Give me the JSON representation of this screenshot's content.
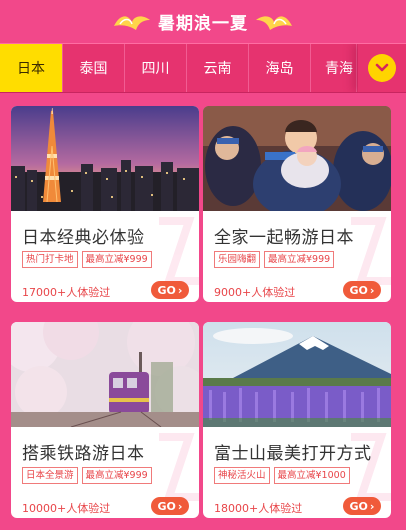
{
  "header": {
    "title": "暑期浪一夏"
  },
  "tabs": [
    {
      "label": "日本",
      "active": true
    },
    {
      "label": "泰国",
      "active": false
    },
    {
      "label": "四川",
      "active": false
    },
    {
      "label": "云南",
      "active": false
    },
    {
      "label": "海岛",
      "active": false
    },
    {
      "label": "青海",
      "active": false
    }
  ],
  "more_icon": "chevron-down-icon",
  "cards": [
    {
      "title": "日本经典必体验",
      "tags": [
        "热门打卡地",
        "最高立减¥999"
      ],
      "people": "17000+人体验过",
      "go": "GO",
      "image": "tokyo-tower-night"
    },
    {
      "title": "全家一起畅游日本",
      "tags": [
        "乐园嗨翻",
        "最高立减¥999"
      ],
      "people": "9000+人体验过",
      "go": "GO",
      "image": "family-festival"
    },
    {
      "title": "搭乘铁路游日本",
      "tags": [
        "日本全景游",
        "最高立减¥999"
      ],
      "people": "10000+人体验过",
      "go": "GO",
      "image": "train-cherry-blossom"
    },
    {
      "title": "富士山最美打开方式",
      "tags": [
        "神秘活火山",
        "最高立减¥1000"
      ],
      "people": "18000+人体验过",
      "go": "GO",
      "image": "mount-fuji-lavender"
    }
  ],
  "colors": {
    "background": "#f2488a",
    "tabbar": "#e6336f",
    "active_tab": "#ffdd00",
    "accent": "#e8464a",
    "go_button": "#f05a3a"
  }
}
